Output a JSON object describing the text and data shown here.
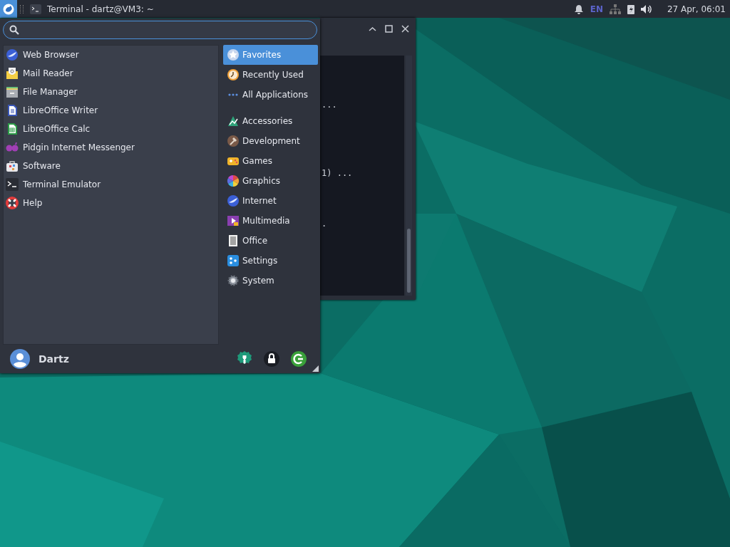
{
  "panel": {
    "tasks": [
      {
        "title": "Terminal - dartz@VM3: ~",
        "selected": false
      }
    ],
    "keyboard_layout": "EN",
    "clock": "27 Apr, 06:01"
  },
  "terminal": {
    "lines": [
      {
        "text": "..."
      },
      {
        "text": "1) ..."
      },
      {
        "text": "."
      }
    ]
  },
  "menu": {
    "favorites": [
      {
        "label": "Web Browser"
      },
      {
        "label": "Mail Reader"
      },
      {
        "label": "File Manager"
      },
      {
        "label": "LibreOffice Writer"
      },
      {
        "label": "LibreOffice Calc"
      },
      {
        "label": "Pidgin Internet Messenger"
      },
      {
        "label": "Software"
      },
      {
        "label": "Terminal Emulator"
      },
      {
        "label": "Help"
      }
    ],
    "categories": [
      {
        "label": "Favorites",
        "selected": true
      },
      {
        "label": "Recently Used",
        "selected": false
      },
      {
        "label": "All Applications",
        "selected": false
      },
      {
        "label": "Accessories",
        "selected": false
      },
      {
        "label": "Development",
        "selected": false
      },
      {
        "label": "Games",
        "selected": false
      },
      {
        "label": "Graphics",
        "selected": false
      },
      {
        "label": "Internet",
        "selected": false
      },
      {
        "label": "Multimedia",
        "selected": false
      },
      {
        "label": "Office",
        "selected": false
      },
      {
        "label": "Settings",
        "selected": false
      },
      {
        "label": "System",
        "selected": false
      }
    ],
    "user": "Dartz"
  }
}
